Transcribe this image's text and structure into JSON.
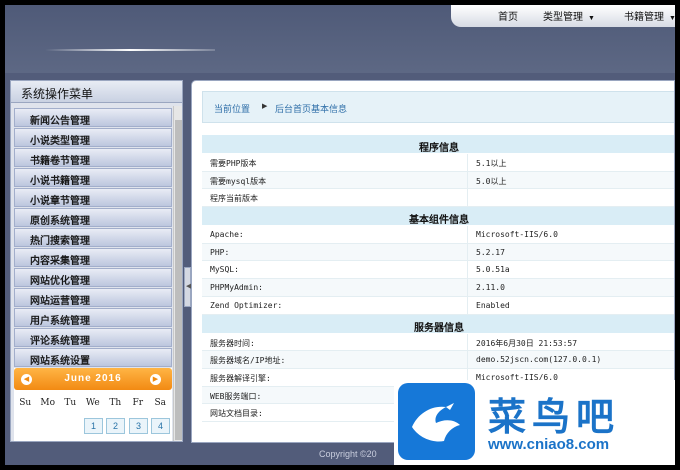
{
  "topnav": {
    "items": [
      {
        "label": "首页",
        "has_menu": false
      },
      {
        "label": "类型管理",
        "has_menu": true
      },
      {
        "label": "书籍管理",
        "has_menu": true
      }
    ]
  },
  "sidebar": {
    "title": "系统操作菜单",
    "items": [
      {
        "label": "新闻公告管理"
      },
      {
        "label": "小说类型管理"
      },
      {
        "label": "书籍卷节管理"
      },
      {
        "label": "小说书籍管理"
      },
      {
        "label": "小说章节管理"
      },
      {
        "label": "原创系统管理"
      },
      {
        "label": "热门搜索管理"
      },
      {
        "label": "内容采集管理"
      },
      {
        "label": "网站优化管理"
      },
      {
        "label": "网站运营管理"
      },
      {
        "label": "用户系统管理"
      },
      {
        "label": "评论系统管理"
      },
      {
        "label": "网站系统设置"
      }
    ]
  },
  "calendar": {
    "month_label": "June 2016",
    "weekdays": [
      "Su",
      "Mo",
      "Tu",
      "We",
      "Th",
      "Fr",
      "Sa"
    ],
    "first_row": [
      "1",
      "2",
      "3",
      "4"
    ]
  },
  "breadcrumb": {
    "home": "当前位置",
    "current": "后台首页基本信息"
  },
  "sections": [
    {
      "title": "程序信息",
      "rows": [
        {
          "label": "需要PHP版本",
          "value": "5.1以上"
        },
        {
          "label": "需要mysql版本",
          "value": "5.0以上"
        },
        {
          "label": "程序当前版本",
          "value": ""
        }
      ]
    },
    {
      "title": "基本组件信息",
      "rows": [
        {
          "label": "Apache:",
          "value": "Microsoft-IIS/6.0"
        },
        {
          "label": "PHP:",
          "value": "5.2.17"
        },
        {
          "label": "MySQL:",
          "value": "5.0.51a"
        },
        {
          "label": "PHPMyAdmin:",
          "value": "2.11.0"
        },
        {
          "label": "Zend Optimizer:",
          "value": "Enabled"
        }
      ]
    },
    {
      "title": "服务器信息",
      "rows": [
        {
          "label": "服务器时间:",
          "value": "2016年6月30日 21:53:57"
        },
        {
          "label": "服务器域名/IP地址:",
          "value": "demo.52jscn.com(127.0.0.1)"
        },
        {
          "label": "服务器解译引擎:",
          "value": "Microsoft-IIS/6.0"
        },
        {
          "label": "WEB服务端口:",
          "value": ""
        },
        {
          "label": "网站文档目录:",
          "value": ""
        }
      ]
    }
  ],
  "footer": {
    "copyright": "Copyright ©20"
  },
  "watermark": {
    "brand": "菜鸟吧",
    "url": "www.cniao8.com"
  },
  "colors": {
    "header": "#525c7a",
    "calendar_accent": "#f28a13",
    "link": "#2f6fa8",
    "section_bg": "#d9edf6",
    "watermark": "#1b73c8"
  }
}
